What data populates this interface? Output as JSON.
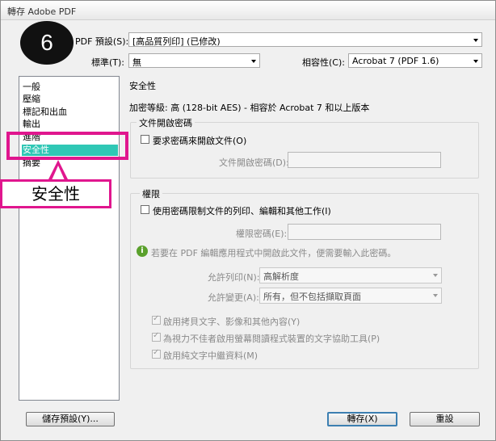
{
  "window": {
    "title": "轉存 Adobe PDF"
  },
  "badge": {
    "number": "6"
  },
  "preset": {
    "label": "PDF 預設(S):",
    "value": "[高品質列印] (已修改)"
  },
  "standard": {
    "label": "標準(T):",
    "value": "無"
  },
  "compat": {
    "label": "相容性(C):",
    "value": "Acrobat 7 (PDF 1.6)"
  },
  "sidebar": {
    "items": [
      {
        "label": "一般"
      },
      {
        "label": "壓縮"
      },
      {
        "label": "標記和出血"
      },
      {
        "label": "輸出"
      },
      {
        "label": "進階"
      },
      {
        "label": "安全性"
      },
      {
        "label": "摘要"
      }
    ],
    "selected_index": 5
  },
  "panel": {
    "title": "安全性",
    "encryption": "加密等級: 高 (128-bit AES) - 相容於 Acrobat 7 和以上版本",
    "open_group": {
      "caption": "文件開啟密碼",
      "require_checkbox": "要求密碼來開啟文件(O)",
      "password_label": "文件開啟密碼(D):"
    },
    "perm_group": {
      "caption": "權限",
      "restrict_checkbox": "使用密碼限制文件的列印、編輯和其他工作(I)",
      "password_label": "權限密碼(E):",
      "info_text": "若要在 PDF 編輯應用程式中開啟此文件，便需要輸入此密碼。",
      "printing_label": "允許列印(N):",
      "printing_value": "高解析度",
      "changes_label": "允許變更(A):",
      "changes_value": "所有，但不包括擷取頁面",
      "opt1": "啟用拷貝文字、影像和其他內容(Y)",
      "opt2": "為視力不佳者啟用螢幕閱讀程式裝置的文字協助工具(P)",
      "opt3": "啟用純文字中繼資料(M)"
    }
  },
  "buttons": {
    "save_preset": "儲存預設(Y)...",
    "export": "轉存(X)",
    "reset": "重設"
  },
  "annotation": {
    "callout": "安全性"
  },
  "colors": {
    "selection": "#2fc7b5",
    "accent": "#e0168e"
  }
}
